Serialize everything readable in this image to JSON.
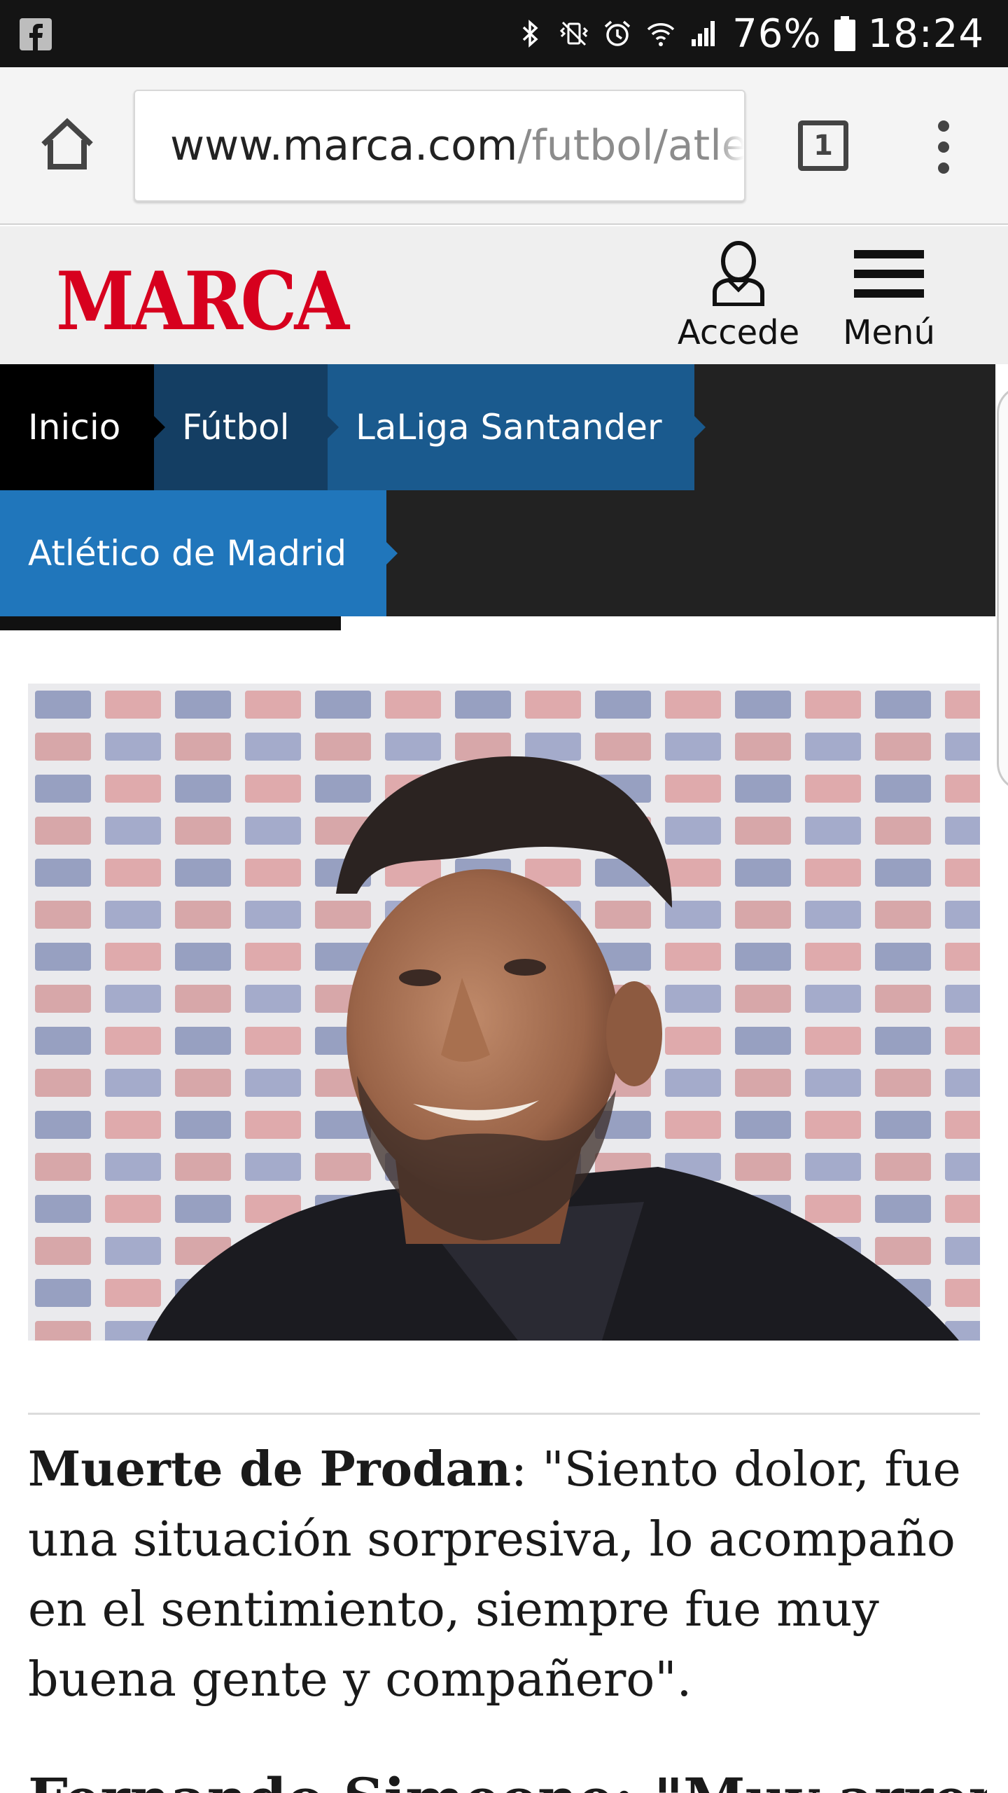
{
  "status_bar": {
    "battery_percent": "76%",
    "time": "18:24",
    "icons": [
      "facebook-icon",
      "bluetooth-icon",
      "vibrate-icon",
      "alarm-icon",
      "wifi-icon",
      "signal-icon",
      "battery-icon"
    ]
  },
  "browser": {
    "url_domain": "www.marca.com",
    "url_path": "/futbol/atle",
    "tab_count": "1"
  },
  "site": {
    "logo": "MARCA",
    "logo_color": "#d7001e",
    "login_label": "Accede",
    "menu_label": "Menú"
  },
  "breadcrumbs": [
    {
      "label": "Inicio",
      "color": "#000000"
    },
    {
      "label": "Fútbol",
      "color": "#143e63"
    },
    {
      "label": "LaLiga Santander",
      "color": "#1a5a8e"
    },
    {
      "label": "Atlético de Madrid",
      "color": "#2076bb"
    }
  ],
  "article": {
    "lead_bold": "Muerte de Prodan",
    "lead_text": ": \"Siento dolor, fue una situación sorpresiva, lo acompaño en el sentimiento, siempre fue muy buena gente y compañero\".",
    "next_headline": "Fernando Simeone: \"Muy arrepentido"
  }
}
